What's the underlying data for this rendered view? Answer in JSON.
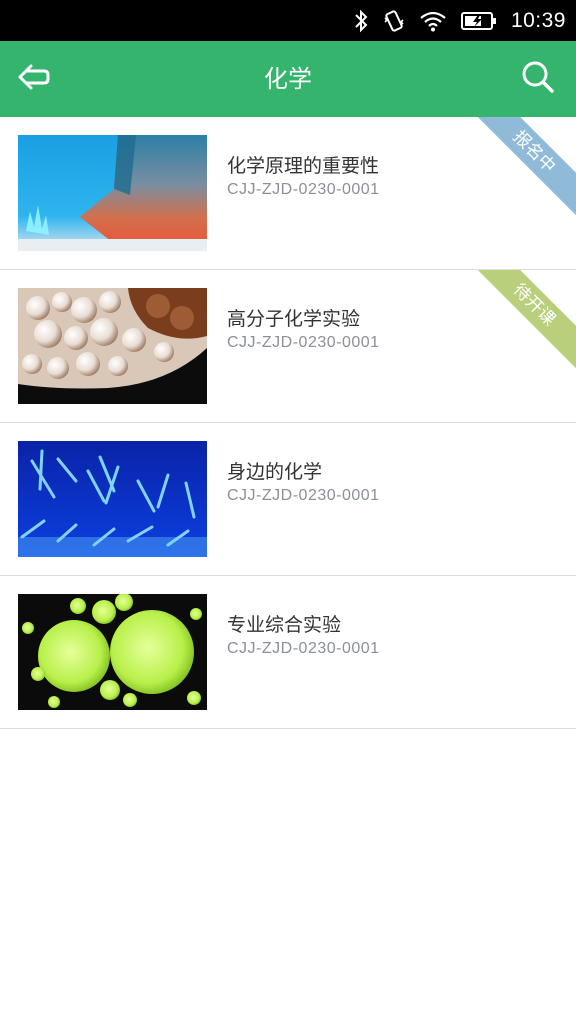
{
  "status_bar": {
    "time": "10:39",
    "icons": [
      "bluetooth-icon",
      "vibrate-icon",
      "wifi-icon",
      "battery-charging-icon"
    ]
  },
  "app_bar": {
    "title": "化学",
    "back_icon": "back-arrow-icon",
    "search_icon": "search-icon",
    "color": "#35b46d"
  },
  "courses": [
    {
      "title": "化学原理的重要性",
      "code": "CJJ-ZJD-0230-0001",
      "badge": "报名中",
      "badge_color": "#8fbbd8",
      "thumbnail": "blue-and-red-crystal-image"
    },
    {
      "title": "高分子化学实验",
      "code": "CJJ-ZJD-0230-0001",
      "badge": "待开课",
      "badge_color": "#b9cf7c",
      "thumbnail": "foam-bubbles-image"
    },
    {
      "title": "身边的化学",
      "code": "CJJ-ZJD-0230-0001",
      "badge": "",
      "thumbnail": "blue-glowing-crystals-image"
    },
    {
      "title": "专业综合实验",
      "code": "CJJ-ZJD-0230-0001",
      "badge": "",
      "thumbnail": "green-glowing-bubbles-image"
    }
  ]
}
